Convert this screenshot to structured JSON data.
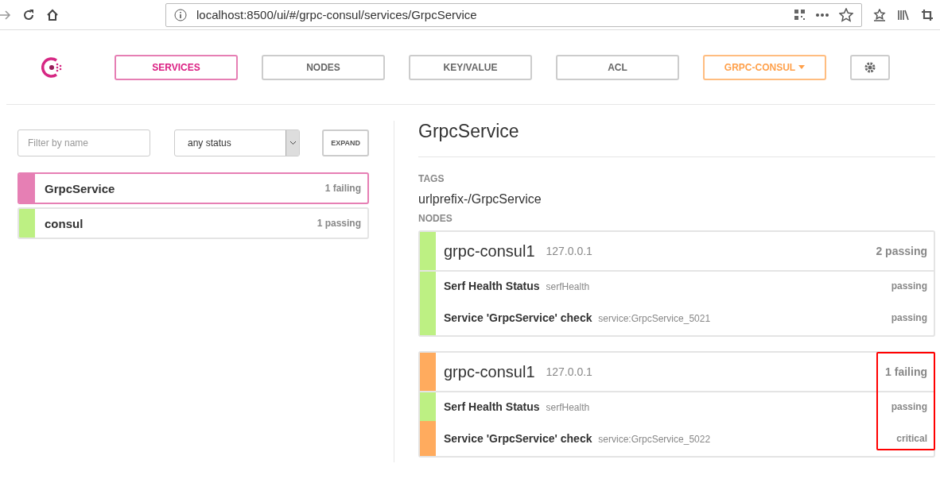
{
  "browser": {
    "url": "localhost:8500/ui/#/grpc-consul/services/GrpcService"
  },
  "nav": [
    {
      "label": "SERVICES",
      "selected": true,
      "kind": "tab"
    },
    {
      "label": "NODES",
      "selected": false,
      "kind": "tab"
    },
    {
      "label": "KEY/VALUE",
      "selected": false,
      "kind": "tab"
    },
    {
      "label": "ACL",
      "selected": false,
      "kind": "tab"
    },
    {
      "label": "GRPC-CONSUL",
      "kind": "datacenter"
    }
  ],
  "filter": {
    "placeholder": "Filter by name",
    "status": "any status",
    "expand": "EXPAND"
  },
  "services": [
    {
      "name": "GrpcService",
      "summary": "1 failing",
      "color": "#e67fb4",
      "selected": true
    },
    {
      "name": "consul",
      "summary": "1 passing",
      "color": "#bdf083",
      "selected": false
    }
  ],
  "detail": {
    "title": "GrpcService",
    "tags_label": "TAGS",
    "tags": "urlprefix-/GrpcService",
    "nodes_label": "NODES",
    "nodes": [
      {
        "name": "grpc-consul1",
        "address": "127.0.0.1",
        "summary": "2 passing",
        "color": "#bdf083",
        "highlighted": false,
        "checks": [
          {
            "name": "Serf Health Status",
            "id": "serfHealth",
            "status_text": "passing",
            "color": "#bdf083"
          },
          {
            "name": "Service 'GrpcService' check",
            "id": "service:GrpcService_5021",
            "status_text": "passing",
            "color": "#bdf083"
          }
        ]
      },
      {
        "name": "grpc-consul1",
        "address": "127.0.0.1",
        "summary": "1 failing",
        "color": "#ffab5e",
        "highlighted": true,
        "checks": [
          {
            "name": "Serf Health Status",
            "id": "serfHealth",
            "status_text": "passing",
            "color": "#bdf083"
          },
          {
            "name": "Service 'GrpcService' check",
            "id": "service:GrpcService_5022",
            "status_text": "critical",
            "color": "#ffab5e"
          }
        ]
      }
    ]
  }
}
